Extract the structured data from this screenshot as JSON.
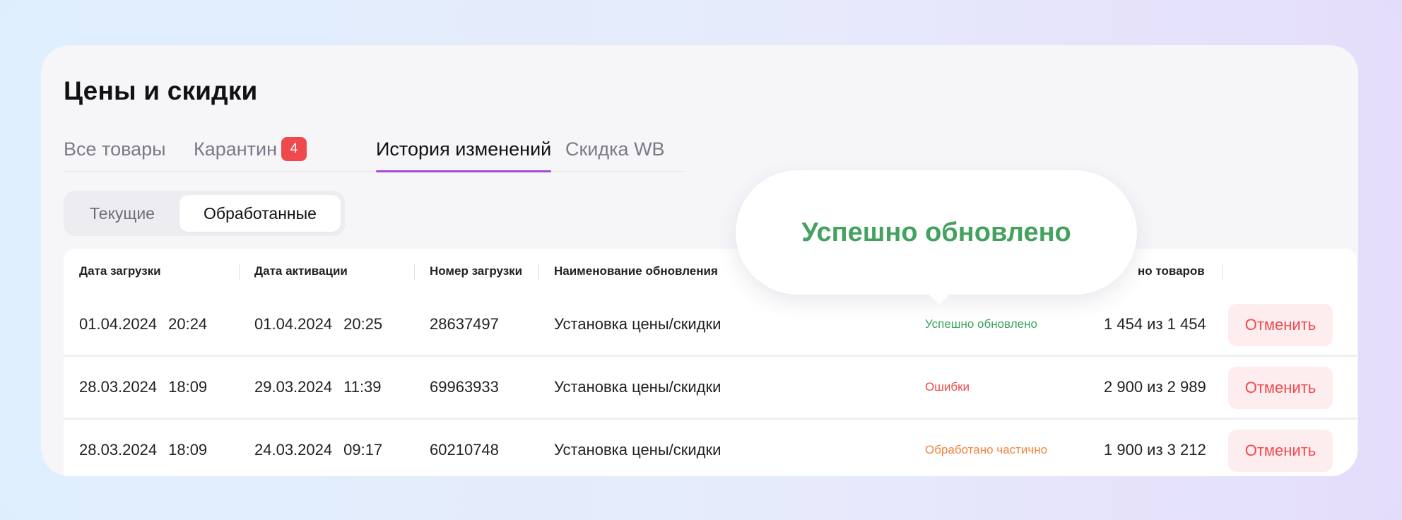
{
  "page": {
    "title": "Цены и скидки"
  },
  "tabs": [
    {
      "label": "Все товары"
    },
    {
      "label": "Карантин",
      "badge": "4"
    },
    {
      "label": "История изменений",
      "active": true
    },
    {
      "label": "Скидка WB"
    }
  ],
  "segment": {
    "current": "Текущие",
    "processed": "Обработанные",
    "selected": "Обработанные"
  },
  "table": {
    "headers": {
      "upload_date": "Дата загрузки",
      "activation_date": "Дата активации",
      "upload_number": "Номер загрузки",
      "update_name": "Наименование обновления",
      "processed_goods": "но товаров"
    },
    "rows": [
      {
        "upload_date": "01.04.2024",
        "upload_time": "20:24",
        "activation_date": "01.04.2024",
        "activation_time": "20:25",
        "number": "28637497",
        "name": "Установка цены/скидки",
        "status": "Успешно обновлено",
        "status_type": "success",
        "count": "1 454  из 1 454",
        "action": "Отменить"
      },
      {
        "upload_date": "28.03.2024",
        "upload_time": "18:09",
        "activation_date": "29.03.2024",
        "activation_time": "11:39",
        "number": "69963933",
        "name": "Установка цены/скидки",
        "status": "Ошибки",
        "status_type": "error",
        "count": "2 900 из 2 989",
        "action": "Отменить"
      },
      {
        "upload_date": "28.03.2024",
        "upload_time": "18:09",
        "activation_date": "24.03.2024",
        "activation_time": "09:17",
        "number": "60210748",
        "name": "Установка цены/скидки",
        "status": "Обработано частично",
        "status_type": "partial",
        "count": "1 900 из 3 212",
        "action": "Отменить"
      }
    ]
  },
  "tooltip": {
    "text": "Успешно обновлено"
  },
  "colors": {
    "accent": "#a24ddb",
    "success": "#3aa55d",
    "error": "#f0494d",
    "partial": "#f2843f",
    "badge": "#f0494d"
  }
}
